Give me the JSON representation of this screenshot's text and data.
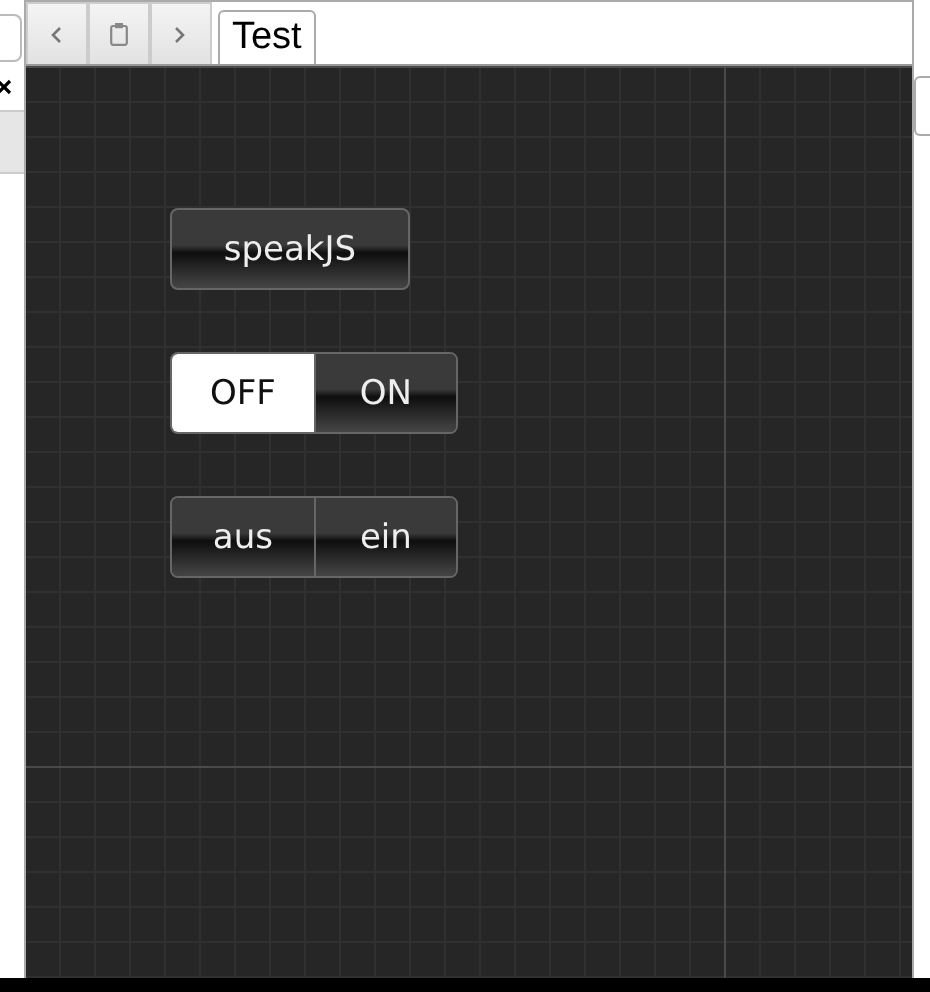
{
  "toolbar": {
    "tab": {
      "label": "Test",
      "selected": true
    }
  },
  "canvas": {
    "controls": [
      {
        "kind": "button",
        "label": "speakJS"
      },
      {
        "kind": "segmented",
        "segments": [
          {
            "label": "OFF",
            "selected": true
          },
          {
            "label": "ON",
            "selected": false
          }
        ]
      },
      {
        "kind": "segmented",
        "segments": [
          {
            "label": "aus",
            "selected": false
          },
          {
            "label": "ein",
            "selected": false
          }
        ]
      }
    ]
  }
}
